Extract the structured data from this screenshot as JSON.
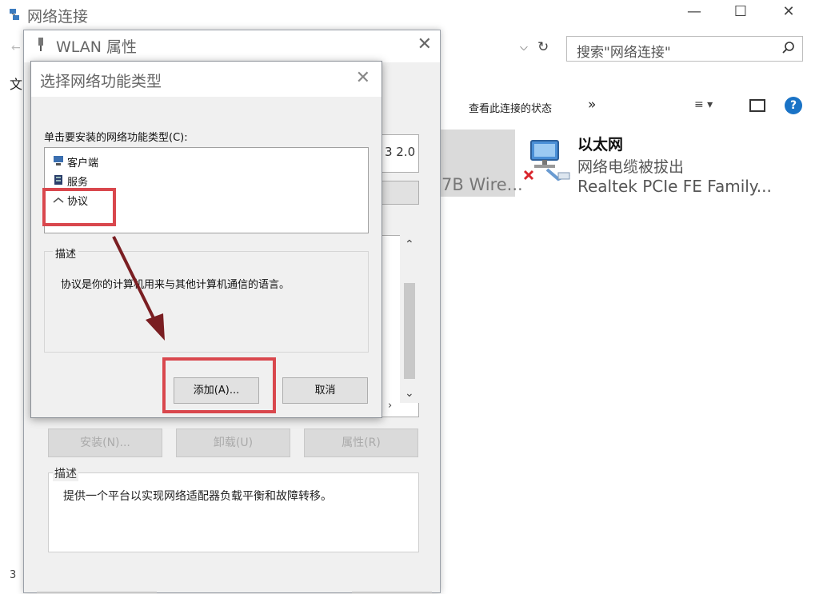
{
  "network_window": {
    "title": "网络连接",
    "window_controls": {
      "minimize": "—",
      "maximize": "☐",
      "close": "✕"
    },
    "back_glyph": "←",
    "menu_file": "文",
    "search_placeholder": "搜索\"网络连接\"",
    "address_dropdown": "⌵",
    "refresh_glyph": "↻",
    "toolbar": {
      "view_status": "查看此连接的状态",
      "more": "»",
      "view_options": "≡ ▾",
      "help": "?"
    },
    "connection_left_fragment": "7B Wire...",
    "ethernet": {
      "name": "以太网",
      "status": "网络电缆被拔出",
      "adapter": "Realtek PCIe FE Family..."
    },
    "bottom_fragment": "3"
  },
  "wlan_dialog": {
    "title": "WLAN 属性",
    "close": "✕",
    "adapter_fragment": "3 2.0",
    "buttons": {
      "install": "安装(N)...",
      "uninstall": "卸载(U)",
      "properties": "属性(R)"
    },
    "description_label": "描述",
    "description_text": "提供一个平台以实现网络适配器负载平衡和故障转移。"
  },
  "select_dialog": {
    "title": "选择网络功能类型",
    "close": "✕",
    "instruction": "单击要安装的网络功能类型(C):",
    "items": [
      {
        "label": "客户端",
        "icon": "client-icon"
      },
      {
        "label": "服务",
        "icon": "service-icon"
      },
      {
        "label": "协议",
        "icon": "protocol-icon"
      }
    ],
    "description_label": "描述",
    "description_text": "协议是你的计算机用来与其他计算机通信的语言。",
    "add_button": "添加(A)...",
    "cancel_button": "取消"
  },
  "annotation_color": "#d9474d"
}
